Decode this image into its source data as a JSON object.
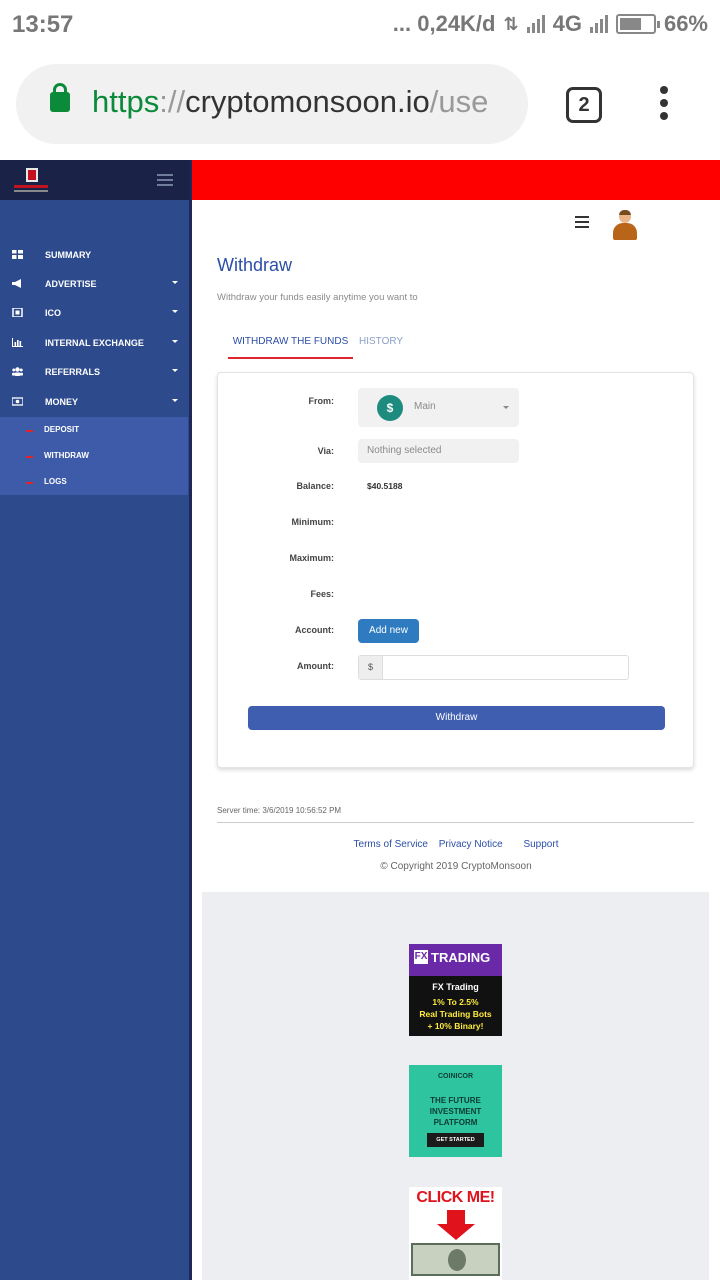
{
  "status_bar": {
    "time": "13:57",
    "network_speed": "... 0,24K/d",
    "network_type": "4G",
    "battery": "66%"
  },
  "browser": {
    "url_scheme": "https",
    "url_sep": "://",
    "url_host": "cryptomonsoon.io",
    "url_path": "/use",
    "tab_count": "2"
  },
  "sidebar": {
    "items": [
      {
        "label": "SUMMARY",
        "icon": "grid-icon"
      },
      {
        "label": "ADVERTISE",
        "icon": "megaphone-icon"
      },
      {
        "label": "ICO",
        "icon": "qr-icon"
      },
      {
        "label": "INTERNAL EXCHANGE",
        "icon": "bar-chart-icon"
      },
      {
        "label": "REFERRALS",
        "icon": "users-icon"
      },
      {
        "label": "MONEY",
        "icon": "money-icon"
      }
    ],
    "money_submenu": [
      {
        "label": "DEPOSIT"
      },
      {
        "label": "WITHDRAW"
      },
      {
        "label": "LOGS"
      }
    ]
  },
  "main": {
    "title": "Withdraw",
    "subtitle": "Withdraw your funds easily anytime you want to",
    "tabs": [
      {
        "label": "WITHDRAW THE FUNDS",
        "active": true
      },
      {
        "label": "HISTORY",
        "active": false
      }
    ],
    "form": {
      "from_label": "From:",
      "from_value": "Main",
      "via_label": "Via:",
      "via_value": "Nothing selected",
      "balance_label": "Balance:",
      "balance_value": "$40.5188",
      "minimum_label": "Minimum:",
      "maximum_label": "Maximum:",
      "fees_label": "Fees:",
      "account_label": "Account:",
      "add_new_label": "Add new",
      "amount_label": "Amount:",
      "amount_addon": "$",
      "amount_value": "",
      "submit_label": "Withdraw"
    },
    "server_time": "Server time: 3/6/2019 10:56:52 PM",
    "footer_links": [
      "Terms of Service",
      "Privacy Notice",
      "Support"
    ],
    "copyright": "© Copyright 2019 CryptoMonsoon"
  },
  "ads": {
    "ad1": {
      "brand": "TRADING",
      "line1": "FX Trading",
      "line2": "1% To 2.5%",
      "line3": "Real Trading Bots",
      "line4": "+ 10% Binary!"
    },
    "ad2": {
      "brand": "COINICOR",
      "line1": "THE FUTURE",
      "line2": "INVESTMENT",
      "line3": "PLATFORM",
      "cta": "GET STARTED"
    },
    "ad3": {
      "text": "CLICK ME!"
    }
  },
  "colors": {
    "accent": "#2b4ea6",
    "sidebar": "#2d4b8c",
    "header_bar": "#ff0000",
    "tab_underline": "#e0262a"
  }
}
